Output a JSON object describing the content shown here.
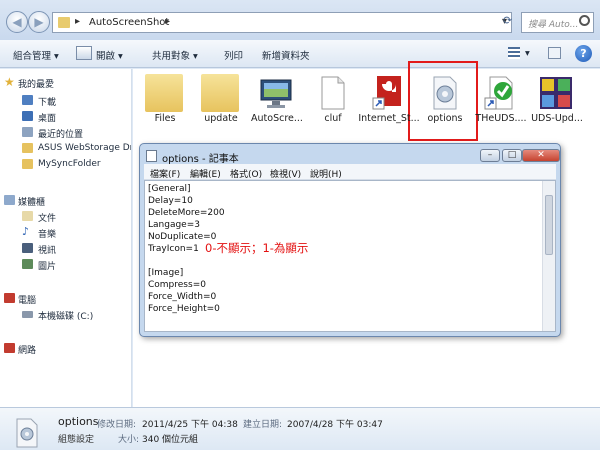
{
  "window": {
    "path": "AutoScreenShot",
    "search_placeholder": "搜尋 Auto..."
  },
  "toolbar": {
    "organize": "組合管理",
    "open": "開啟",
    "share": "共用對象",
    "print": "列印",
    "new_folder": "新增資料夾"
  },
  "sidebar": {
    "favorites": "我的最愛",
    "downloads": "下載",
    "desktop": "桌面",
    "recent": "最近的位置",
    "asus": "ASUS WebStorage Dr",
    "mysync": "MySyncFolder",
    "libraries": "媒體櫃",
    "docs": "文件",
    "music": "音樂",
    "videos": "視訊",
    "pictures": "圖片",
    "computer": "電腦",
    "local_disk": "本機磁碟 (C:)",
    "network": "網路"
  },
  "files": [
    {
      "name": "Files",
      "icon": "folder-icon"
    },
    {
      "name": "update",
      "icon": "folder-icon"
    },
    {
      "name": "AutoScre...",
      "icon": "monitor-app-icon"
    },
    {
      "name": "cluf",
      "icon": "text-file-icon"
    },
    {
      "name": "Internet_St...",
      "icon": "shortcut-icon"
    },
    {
      "name": "options",
      "icon": "config-file-icon"
    },
    {
      "name": "THeUDS....",
      "icon": "checkmark-app-icon"
    },
    {
      "name": "UDS-Upd...",
      "icon": "arrows-app-icon"
    }
  ],
  "notepad": {
    "title": "options - 記事本",
    "menu": [
      "檔案(F)",
      "編輯(E)",
      "格式(O)",
      "檢視(V)",
      "說明(H)"
    ],
    "lines": [
      "[General]",
      "Delay=10",
      "DeleteMore=200",
      "Langage=3",
      "NoDuplicate=0",
      "TrayIcon=1",
      "",
      "[Image]",
      "Compress=0",
      "Force_Width=0",
      "Force_Height=0"
    ],
    "annotation": "0-不顯示；1-為顯示"
  },
  "status": {
    "name": "options",
    "type": "組態設定",
    "modified_label": "修改日期:",
    "modified_value": "2011/4/25 下午 04:38",
    "created_label": "建立日期:",
    "created_value": "2007/4/28 下午 03:47",
    "size_label": "大小:",
    "size_value": "340 個位元組"
  },
  "colors": {
    "highlight_border": "#e21b1b",
    "annotation": "#e31111"
  }
}
